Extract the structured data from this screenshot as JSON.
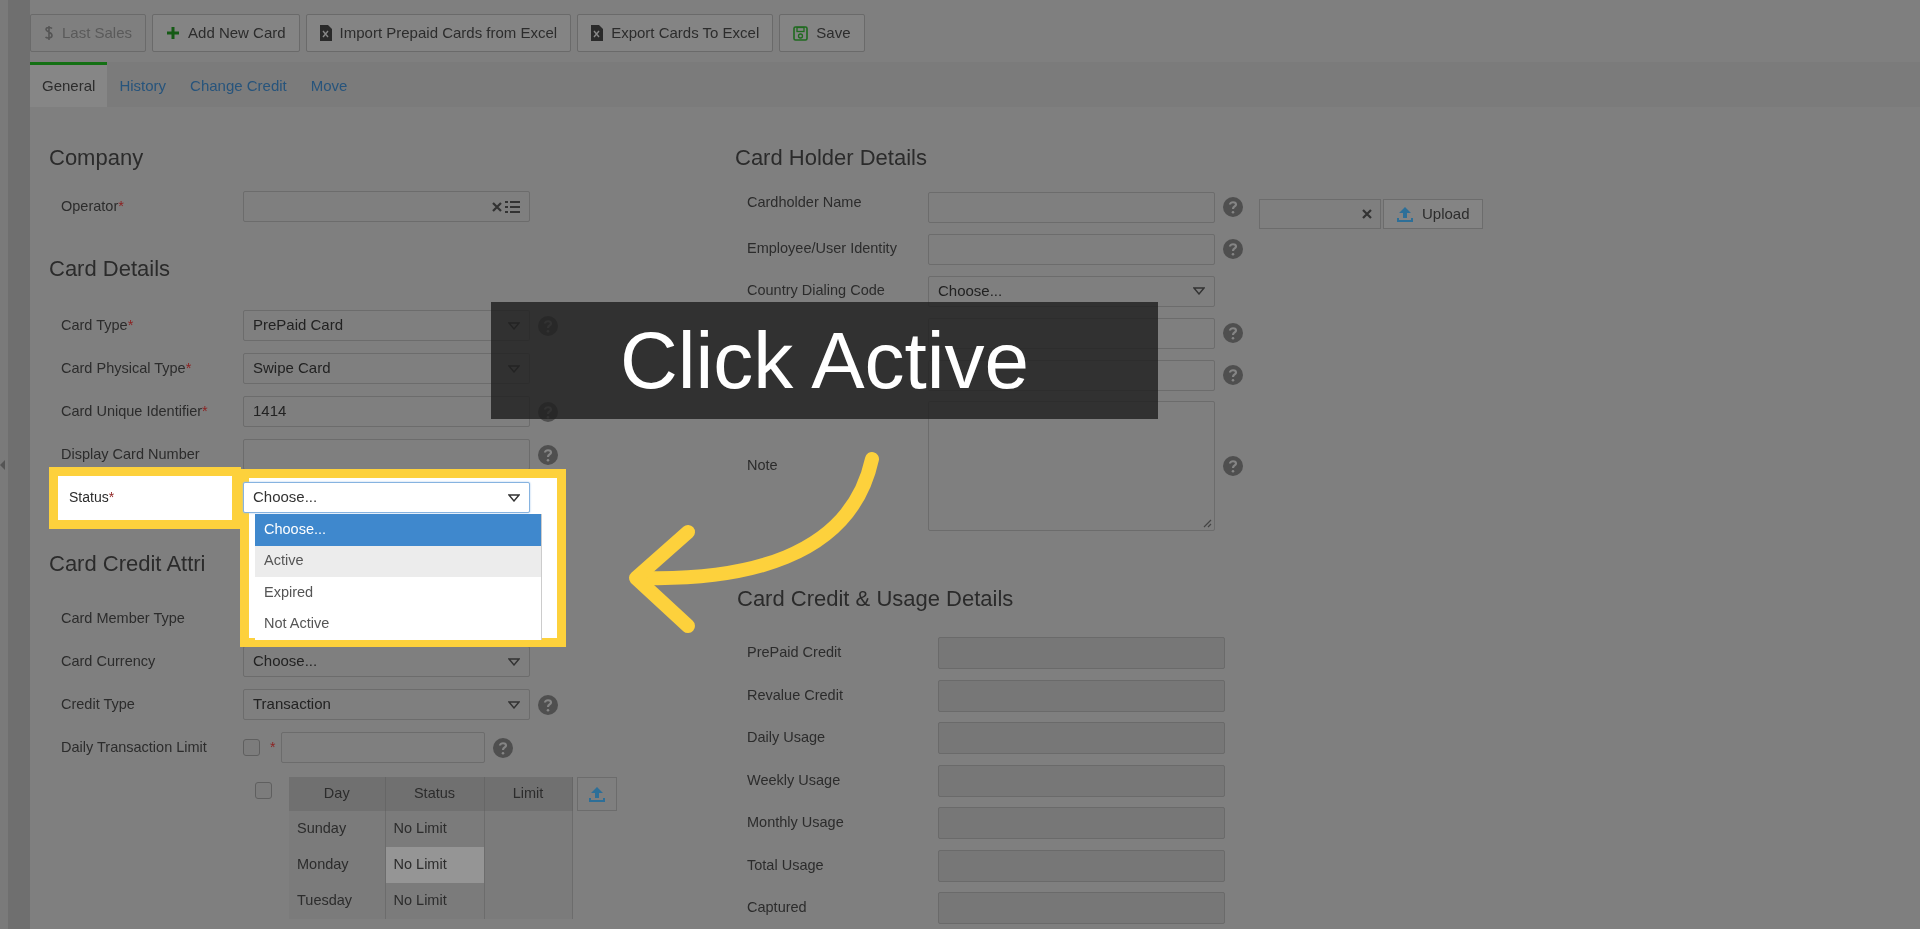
{
  "toolbar": [
    {
      "label": "Last Sales",
      "disabled": true
    },
    {
      "label": "Add New Card",
      "disabled": false
    },
    {
      "label": "Import Prepaid Cards from Excel",
      "disabled": false
    },
    {
      "label": "Export Cards To Excel",
      "disabled": false
    },
    {
      "label": "Save",
      "disabled": false
    }
  ],
  "tabs": [
    {
      "label": "General",
      "selected": true
    },
    {
      "label": "History",
      "selected": false
    },
    {
      "label": "Change Credit",
      "selected": false
    },
    {
      "label": "Move",
      "selected": false
    }
  ],
  "left_sections": [
    {
      "heading": "Company",
      "fields": [
        {
          "label": "Operator",
          "mark": "*",
          "kind": "lookup",
          "help": false
        }
      ]
    },
    {
      "heading": "Card Details",
      "fields": [
        {
          "label": "Card Type",
          "mark": "*",
          "kind": "select",
          "value": "PrePaid Card",
          "help": true
        },
        {
          "label": "Card Physical Type",
          "mark": "*",
          "kind": "select",
          "value": "Swipe Card",
          "help": false
        },
        {
          "label": "Card Unique Identifier",
          "mark": "*",
          "kind": "text",
          "value": "1414",
          "help": true
        },
        {
          "label": "Display Card Number",
          "kind": "text",
          "help": true
        },
        {
          "label": "Status",
          "mark": "*",
          "kind": "dropdown",
          "value": "Choose...",
          "help": false,
          "highlighted": true,
          "options": [
            {
              "label": "Choose...",
              "selected": true,
              "hovered": false
            },
            {
              "label": "Active",
              "selected": false,
              "hovered": true
            },
            {
              "label": "Expired",
              "selected": false,
              "hovered": false
            },
            {
              "label": "Not Active",
              "selected": false,
              "hovered": false
            }
          ]
        }
      ]
    },
    {
      "heading": "Card Credit Attri",
      "fields": [
        {
          "label": "Card Member Type",
          "kind": "label",
          "help": false
        },
        {
          "label": "Card Currency",
          "kind": "select",
          "value": "Choose...",
          "help": false
        },
        {
          "label": "Credit Type",
          "kind": "select",
          "value": "Transaction",
          "help": true
        },
        {
          "label": "Daily Transaction Limit",
          "mark": "*",
          "kind": "check_text",
          "checked": false,
          "help": true
        }
      ]
    }
  ],
  "limit_table": {
    "checked": false,
    "columns": [
      "Day",
      "Status",
      "Limit"
    ],
    "rows": [
      {
        "day": "Sunday",
        "status": "No Limit",
        "highlighted": false
      },
      {
        "day": "Monday",
        "status": "No Limit",
        "highlighted": true
      },
      {
        "day": "Tuesday",
        "status": "No Limit",
        "highlighted": false
      }
    ]
  },
  "card_holder": {
    "heading": "Card Holder Details",
    "fields": [
      {
        "label": "Cardholder Name",
        "kind": "text",
        "help": true,
        "upload": {
          "button": "Upload"
        }
      },
      {
        "label": "Employee/User Identity",
        "kind": "text",
        "help": true
      },
      {
        "label": "Country Dialing Code",
        "kind": "select",
        "value": "Choose...",
        "help": false
      },
      {
        "kind": "text",
        "help": true
      },
      {
        "kind": "text",
        "help": true
      },
      {
        "label": "Note",
        "kind": "textarea",
        "help": true
      }
    ]
  },
  "usage": {
    "heading": "Card Credit & Usage Details",
    "fields": [
      "PrePaid Credit",
      "Revalue Credit",
      "Daily Usage",
      "Weekly Usage",
      "Monthly Usage",
      "Total Usage",
      "Captured"
    ]
  },
  "callout": {
    "text": "Click Active"
  }
}
